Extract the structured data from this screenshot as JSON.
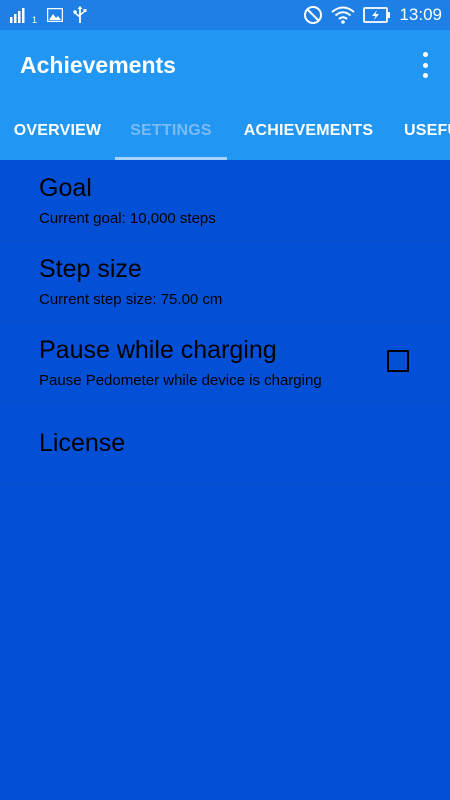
{
  "status_bar": {
    "time": "13:09",
    "sim_label": "1",
    "icons": [
      "signal-icon",
      "image-icon",
      "usb-icon",
      "do-not-disturb-icon",
      "wifi-icon",
      "battery-charging-icon"
    ]
  },
  "app_bar": {
    "title": "Achievements",
    "menu_icon": "more-vert-icon"
  },
  "tabs": [
    {
      "label": "OVERVIEW",
      "active": false
    },
    {
      "label": "SETTINGS",
      "active": true
    },
    {
      "label": "ACHIEVEMENTS",
      "active": false
    },
    {
      "label": "USEFU",
      "active": false
    }
  ],
  "preferences": [
    {
      "title": "Goal",
      "summary": "Current goal: 10,000 steps"
    },
    {
      "title": "Step size",
      "summary": "Current step size: 75.00 cm"
    },
    {
      "title": "Pause while charging",
      "summary": "Pause Pedometer while device is charging",
      "checked": false
    },
    {
      "title": "License"
    }
  ],
  "colors": {
    "status_bar": "#1e7fe6",
    "app_bar": "#2196f3",
    "content_bg": "#0350d6",
    "active_tab_text": "#7cbaf2",
    "indicator": "#a8d2ff"
  }
}
